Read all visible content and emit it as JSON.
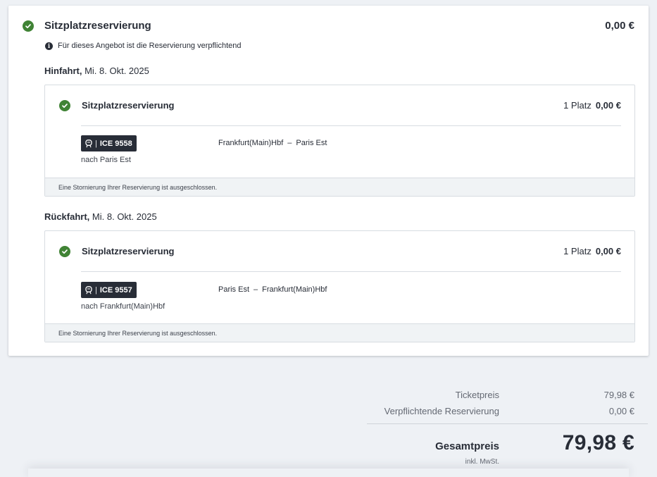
{
  "header": {
    "title": "Sitzplatzreservierung",
    "price": "0,00 €",
    "info": "Für dieses Angebot ist die Reservierung verpflichtend"
  },
  "outbound": {
    "label": "Hinfahrt,",
    "date": "Mi. 8. Okt. 2025",
    "title": "Sitzplatzreservierung",
    "seats": "1 Platz",
    "price": "0,00 €",
    "train": "ICE 9558",
    "destination": "nach Paris Est",
    "from": "Frankfurt(Main)Hbf",
    "to": "Paris Est",
    "note": "Eine Stornierung Ihrer Reservierung ist ausgeschlossen."
  },
  "return": {
    "label": "Rückfahrt,",
    "date": "Mi. 8. Okt. 2025",
    "title": "Sitzplatzreservierung",
    "seats": "1 Platz",
    "price": "0,00 €",
    "train": "ICE 9557",
    "destination": "nach Frankfurt(Main)Hbf",
    "from": "Paris Est",
    "to": "Frankfurt(Main)Hbf",
    "note": "Eine Stornierung Ihrer Reservierung ist ausgeschlossen."
  },
  "summary": {
    "ticket_label": "Ticketpreis",
    "ticket_price": "79,98 €",
    "reservation_label": "Verpflichtende Reservierung",
    "reservation_price": "0,00 €",
    "total_label": "Gesamtpreis",
    "total_price": "79,98 €",
    "tax_note": "inkl. MwSt."
  },
  "colors": {
    "check": "#408335",
    "badge": "#282d37",
    "background": "#eef1f5"
  },
  "icons": {
    "check": "check-circle-icon",
    "info": "info-icon",
    "train": "train-icon"
  }
}
